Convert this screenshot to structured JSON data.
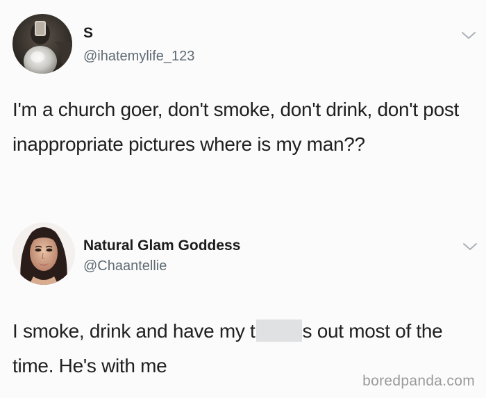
{
  "tweets": [
    {
      "display_name": "S",
      "handle": "@ihatemylife_123",
      "body": "I'm a church goer, don't smoke, don't drink, don't post inappropriate pictures where is my man??",
      "avatar_icon": "profile-photo-dark"
    },
    {
      "display_name": "Natural Glam Goddess",
      "handle": "@Chaantellie",
      "body_before_censor": "I smoke, drink and have my t",
      "body_after_censor": "s out most of the time. He's with me",
      "avatar_icon": "profile-photo-woman"
    }
  ],
  "watermark": "boredpanda.com",
  "colors": {
    "text": "#202020",
    "handle": "#5f6a73",
    "chevron": "#aab1b8",
    "censor": "#dfe1e3",
    "watermark": "#8a8a8a"
  }
}
